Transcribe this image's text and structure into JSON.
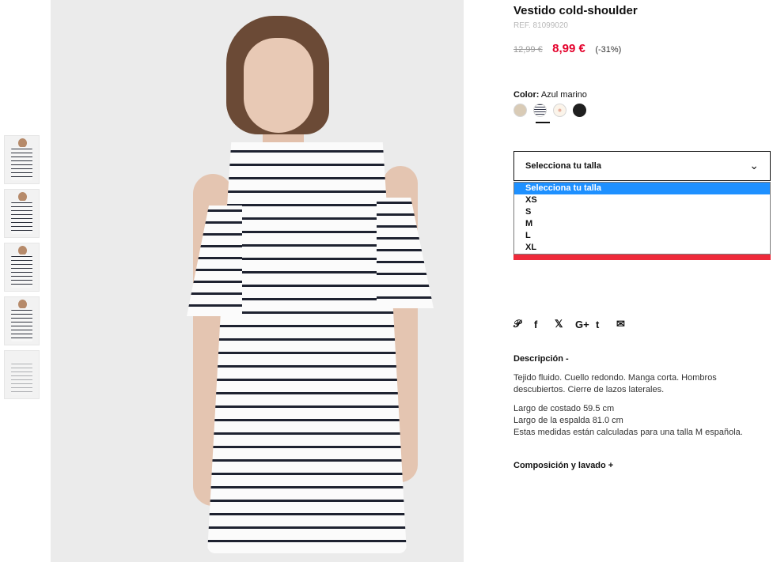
{
  "product": {
    "title": "Vestido cold-shoulder",
    "ref": "REF. 81099020",
    "old_price": "12,99 €",
    "new_price": "8,99 €",
    "discount": "(-31%)"
  },
  "color": {
    "label": "Color:",
    "value": "Azul marino",
    "swatches": [
      "beige",
      "azul-marino-rayas",
      "floral",
      "negro"
    ]
  },
  "size": {
    "select_label": "Selecciona tu talla",
    "options": [
      "Selecciona tu talla",
      "XS",
      "S",
      "M",
      "L",
      "XL"
    ],
    "selected_index": 0
  },
  "social": {
    "icons": [
      "pinterest-icon",
      "facebook-icon",
      "twitter-icon",
      "google-plus-icon",
      "tumblr-icon",
      "email-icon"
    ],
    "glyphs": [
      "𝒫",
      "f",
      "🐦",
      "G+",
      "t",
      "✉"
    ]
  },
  "description": {
    "title": "Descripción -",
    "paragraph1": "Tejido fluido. Cuello redondo. Manga corta. Hombros descubiertos. Cierre de lazos laterales.",
    "line1": "Largo de costado 59.5 cm",
    "line2": "Largo de la espalda 81.0 cm",
    "line3": "Estas medidas están calculadas para una talla M española."
  },
  "composition": {
    "title": "Composición y lavado +"
  },
  "colors": {
    "price_red": "#e4002b",
    "dropdown_highlight": "#1e90ff",
    "add_bar": "#ee2a3a"
  }
}
